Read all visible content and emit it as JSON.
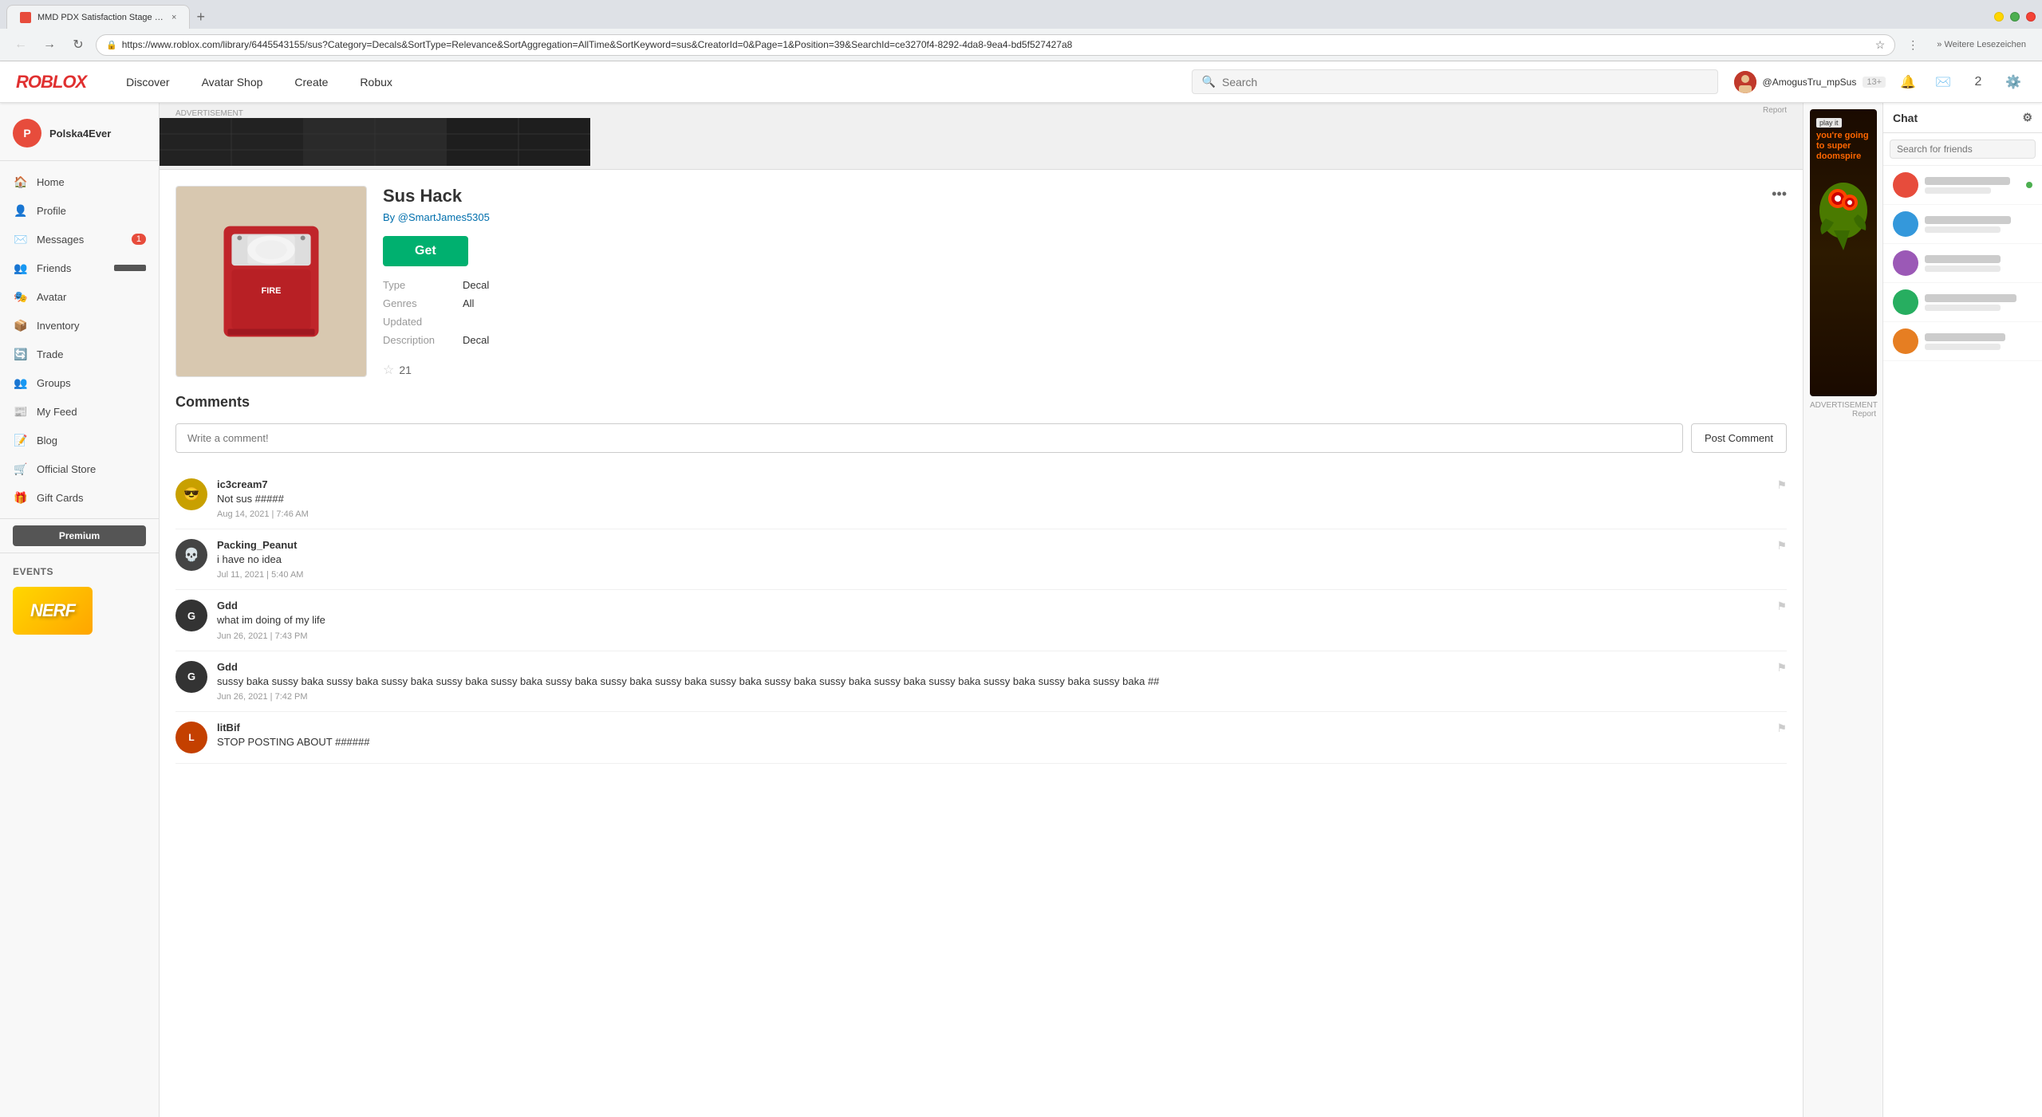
{
  "browser": {
    "tab_title": "MMD PDX Satisfaction Stage : D ×",
    "url": "https://www.roblox.com/library/6445543155/sus?Category=Decals&SortType=Relevance&SortAggregation=AllTime&SortKeyword=sus&CreatorId=0&Page=1&Position=39&SearchId=ce3270f4-8292-4da8-9ea4-bd5f527427a8",
    "new_tab_plus": "+",
    "nav_back": "←",
    "nav_forward": "→",
    "nav_refresh": "↻",
    "extensions_label": "» Weitere Lesezeichen"
  },
  "roblox_nav": {
    "logo": "ROBLOX",
    "links": [
      "Discover",
      "Avatar Shop",
      "Create",
      "Robux"
    ],
    "search_placeholder": "Search",
    "username": "@AmogusTru_mpSus",
    "age_rating": "13+",
    "robux_count": "2"
  },
  "sidebar": {
    "username": "Polska4Ever",
    "items": [
      {
        "label": "Home",
        "icon": "🏠"
      },
      {
        "label": "Profile",
        "icon": "👤"
      },
      {
        "label": "Messages",
        "icon": "✉️",
        "count": "1"
      },
      {
        "label": "Friends",
        "icon": "👥",
        "has_bar": true
      },
      {
        "label": "Avatar",
        "icon": "🎭"
      },
      {
        "label": "Inventory",
        "icon": "📦"
      },
      {
        "label": "Trade",
        "icon": "🔄"
      },
      {
        "label": "Groups",
        "icon": "👥"
      },
      {
        "label": "My Feed",
        "icon": "📰"
      },
      {
        "label": "Blog",
        "icon": "📝"
      },
      {
        "label": "Official Store",
        "icon": "🛒"
      },
      {
        "label": "Gift Cards",
        "icon": "🎁"
      }
    ],
    "premium_label": "Premium",
    "events_label": "Events",
    "nerf_text": "NERF"
  },
  "item": {
    "title": "Sus Hack",
    "author": "By @SmartJames5305",
    "more_icon": "•••",
    "get_label": "Get",
    "type_label": "Type",
    "type_value": "Decal",
    "genres_label": "Genres",
    "genres_value": "All",
    "updated_label": "Updated",
    "description_label": "Description",
    "description_value": "Decal",
    "rating": "21",
    "star_icon": "☆"
  },
  "comments": {
    "title": "Comments",
    "input_placeholder": "Write a comment!",
    "post_btn": "Post Comment",
    "items": [
      {
        "username": "ic3cream7",
        "text": "Not sus #####",
        "date": "Aug 14, 2021 | 7:46 AM",
        "avatar_color": "#c8a000"
      },
      {
        "username": "Packing_Peanut",
        "text": "i have no idea",
        "date": "Jul 11, 2021 | 5:40 AM",
        "avatar_color": "#333"
      },
      {
        "username": "Gdd",
        "text": "what im doing of my life",
        "date": "Jun 26, 2021 | 7:43 PM",
        "avatar_color": "#333"
      },
      {
        "username": "Gdd",
        "text": "sussy baka sussy baka sussy baka sussy baka sussy baka sussy baka sussy baka sussy baka sussy baka sussy baka sussy baka sussy baka sussy baka sussy baka sussy baka sussy baka sussy baka ##",
        "date": "Jun 26, 2021 | 7:42 PM",
        "avatar_color": "#333"
      },
      {
        "username": "litBif",
        "text": "STOP POSTING ABOUT ######",
        "date": "",
        "avatar_color": "#c44000"
      }
    ]
  },
  "ad": {
    "label": "ADVERTISEMENT",
    "report": "Report",
    "play_it": "play it",
    "title": "you're going to super doomspire"
  },
  "chat": {
    "title": "Chat",
    "search_placeholder": "Search for friends",
    "items": [
      {
        "name": "",
        "preview": "",
        "online": true
      },
      {
        "name": "",
        "preview": "",
        "online": false
      },
      {
        "name": "",
        "preview": "",
        "online": false
      },
      {
        "name": "",
        "preview": "",
        "online": false
      },
      {
        "name": "",
        "preview": "",
        "online": false
      }
    ]
  }
}
